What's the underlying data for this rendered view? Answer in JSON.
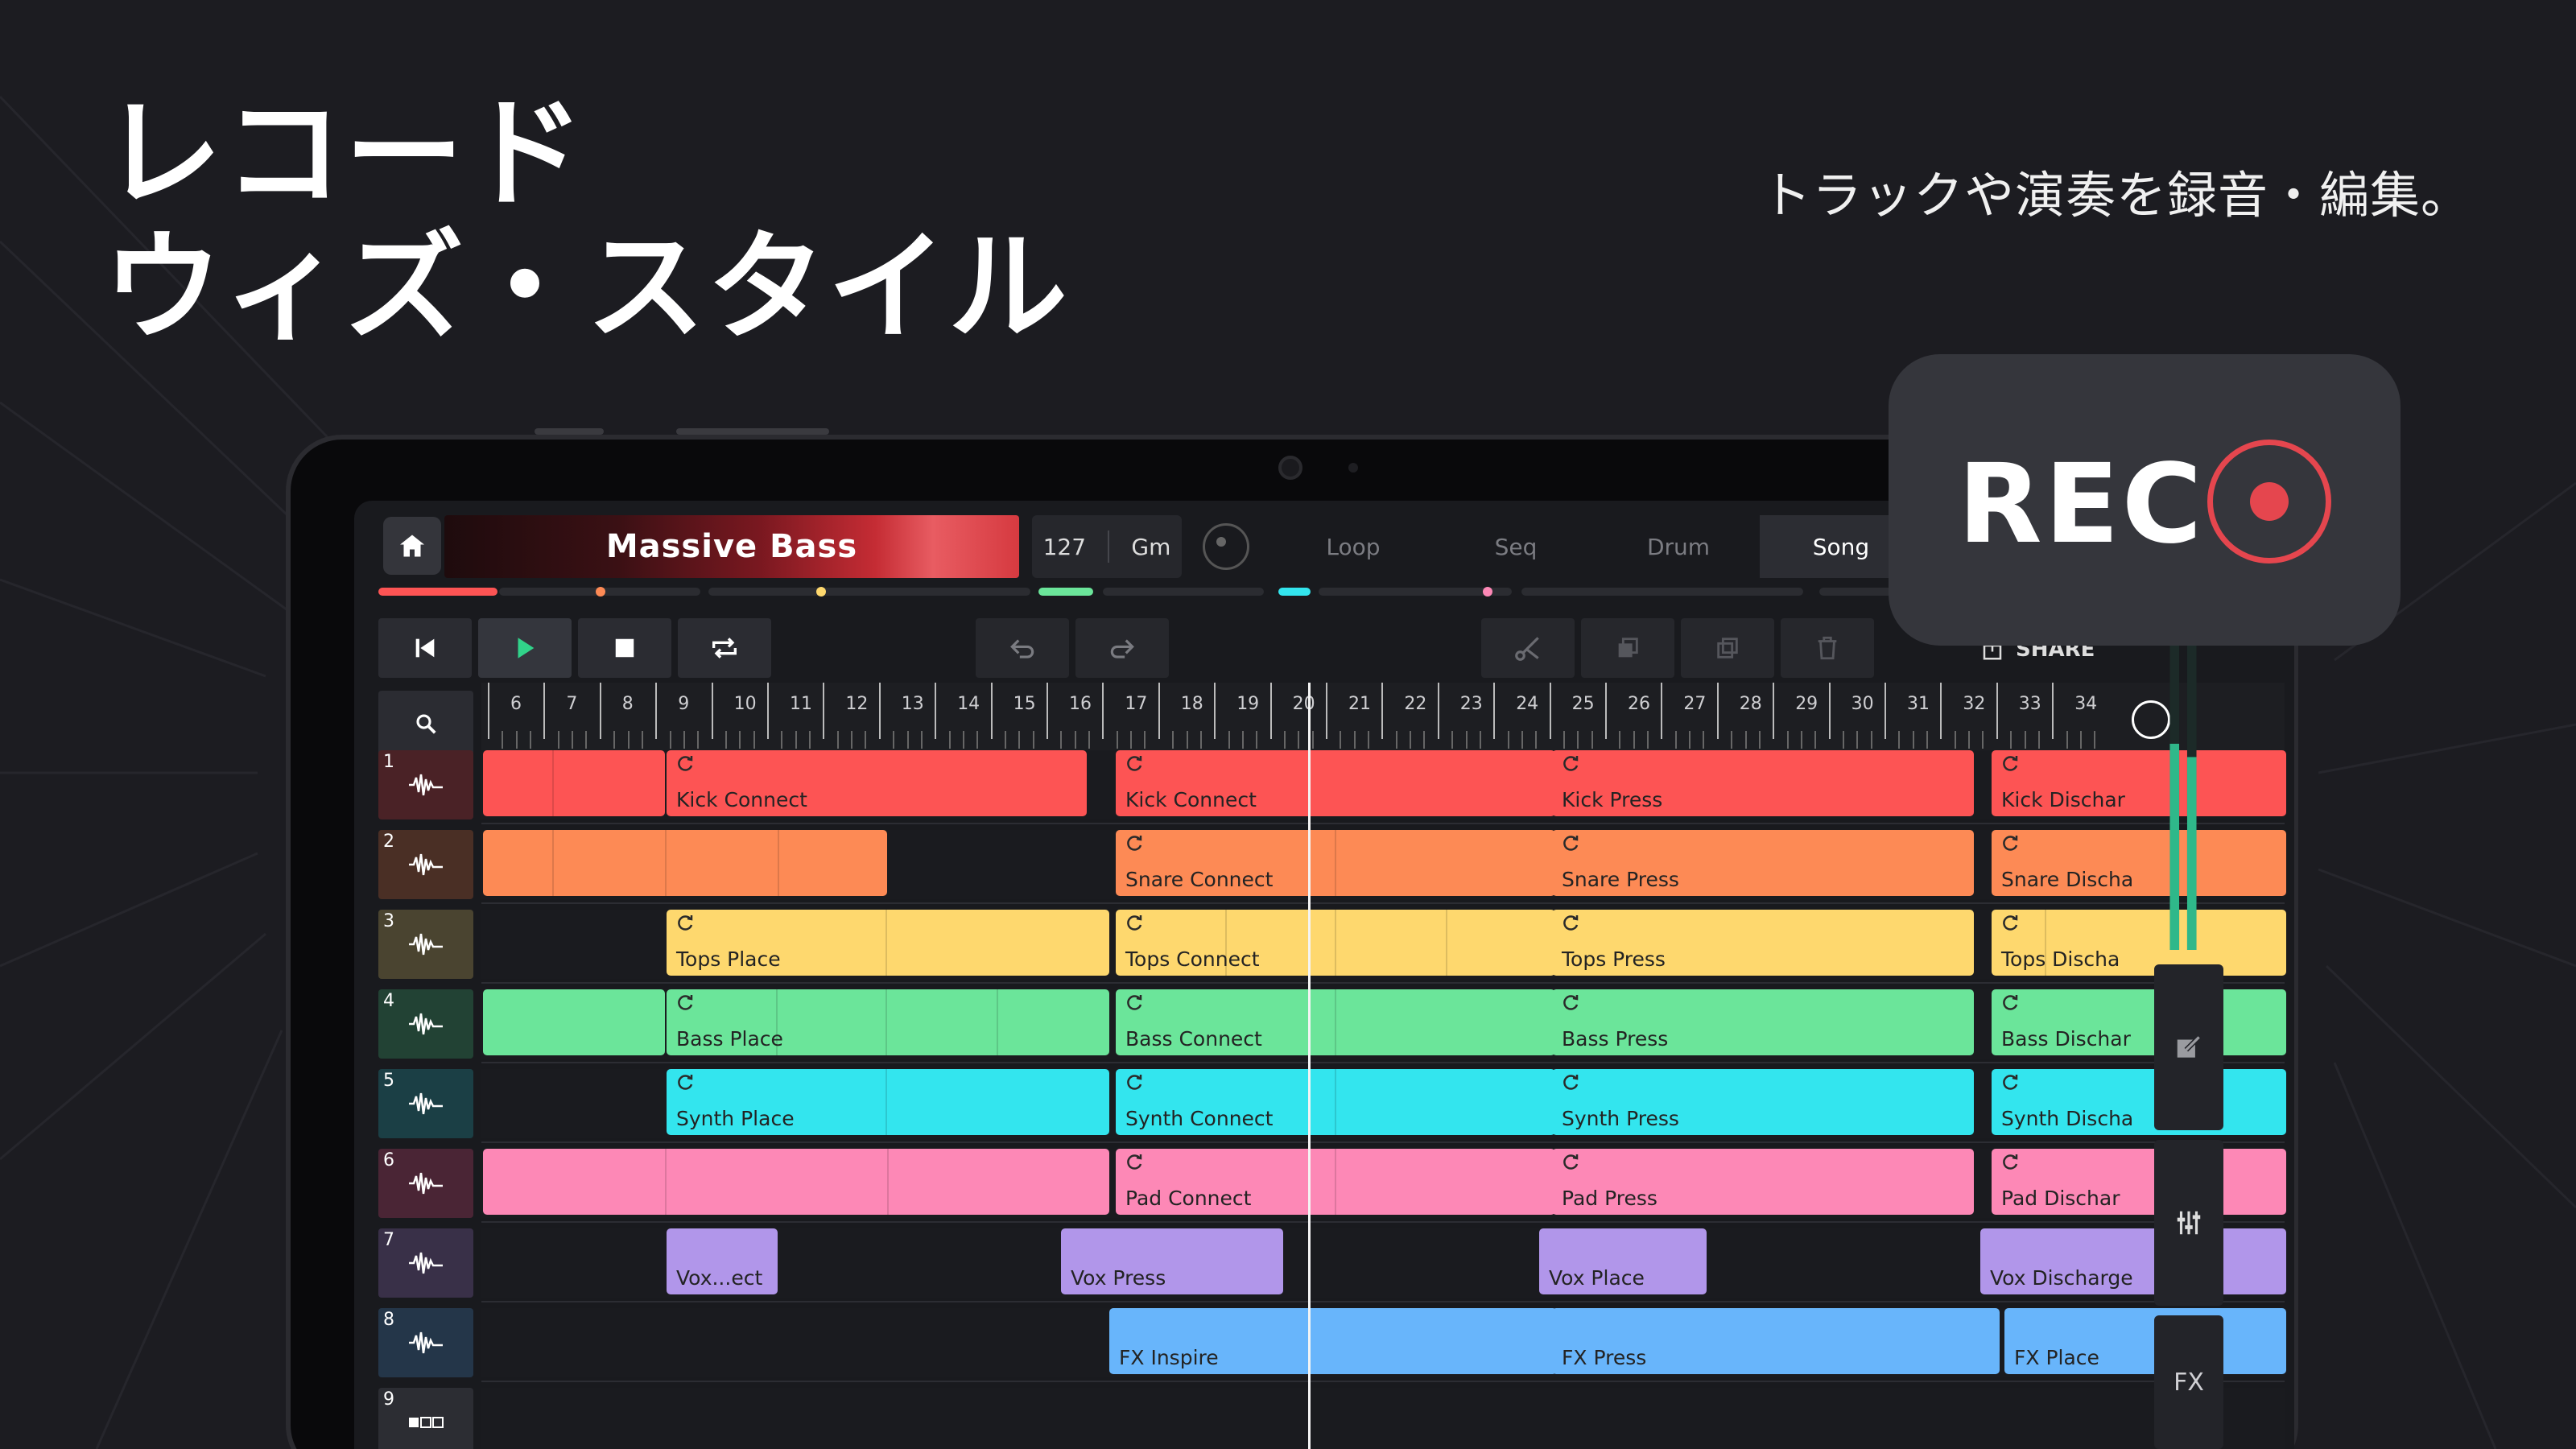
{
  "headline": "レコード\nウィズ・スタイル",
  "subheadline": "トラックや演奏を録音・編集。",
  "rec_badge": {
    "label": "REC",
    "color": "#e5464e"
  },
  "topbar": {
    "home_icon": "home-icon",
    "song_title": "Massive Bass",
    "tempo": "127",
    "key": "Gm",
    "tabs": [
      {
        "label": "Loop",
        "active": false
      },
      {
        "label": "Seq",
        "active": false
      },
      {
        "label": "Drum",
        "active": false
      },
      {
        "label": "Song",
        "active": true
      }
    ]
  },
  "transport": {
    "buttons": [
      "skip-back-icon",
      "play-icon",
      "stop-icon",
      "loop-icon"
    ],
    "edit_buttons": [
      "undo-icon",
      "redo-icon",
      "scissors-icon",
      "duplicate-icon",
      "copy-icon",
      "trash-icon"
    ],
    "share_label": "SHARE"
  },
  "ruler": {
    "bars": [
      "6",
      "7",
      "8",
      "9",
      "10",
      "11",
      "12",
      "13",
      "14",
      "15",
      "16",
      "17",
      "18",
      "19",
      "20",
      "21",
      "22",
      "23",
      "24",
      "25",
      "26",
      "27",
      "28",
      "29",
      "30",
      "31",
      "32",
      "33",
      "34"
    ]
  },
  "tracks": [
    {
      "number": "1",
      "color": "#fd5454",
      "head": "#4a2226",
      "clips": [
        {
          "label": ""
        },
        {
          "label": "Kick Connect"
        },
        {
          "label": "Kick Connect"
        },
        {
          "label": "Kick Press"
        },
        {
          "label": "Kick Dischar"
        }
      ]
    },
    {
      "number": "2",
      "color": "#fd8a55",
      "head": "#4a2f25",
      "clips": [
        {
          "label": ""
        },
        {
          "label": "Snare Connect"
        },
        {
          "label": "Snare Press"
        },
        {
          "label": "Snare Discha"
        }
      ]
    },
    {
      "number": "3",
      "color": "#fed86e",
      "head": "#4a4430",
      "clips": [
        {
          "label": "Tops Place"
        },
        {
          "label": "Tops Connect"
        },
        {
          "label": "Tops Press"
        },
        {
          "label": "Tops Discha"
        }
      ]
    },
    {
      "number": "4",
      "color": "#6be59a",
      "head": "#224234",
      "clips": [
        {
          "label": ""
        },
        {
          "label": "Bass Place"
        },
        {
          "label": "Bass Connect"
        },
        {
          "label": "Bass Press"
        },
        {
          "label": "Bass Dischar"
        }
      ]
    },
    {
      "number": "5",
      "color": "#33e5ee",
      "head": "#1b3f45",
      "clips": [
        {
          "label": "Synth Place"
        },
        {
          "label": "Synth Connect"
        },
        {
          "label": "Synth Press"
        },
        {
          "label": "Synth Discha"
        }
      ]
    },
    {
      "number": "6",
      "color": "#fd88b6",
      "head": "#4a2535",
      "clips": [
        {
          "label": ""
        },
        {
          "label": "Pad Connect"
        },
        {
          "label": "Pad Press"
        },
        {
          "label": "Pad Dischar"
        }
      ]
    },
    {
      "number": "7",
      "color": "#b196ea",
      "head": "#393048",
      "clips": [
        {
          "label": "Vox...ect"
        },
        {
          "label": "Vox Press"
        },
        {
          "label": "Vox Place"
        },
        {
          "label": "Vox Discharge"
        }
      ]
    },
    {
      "number": "8",
      "color": "#68b5fb",
      "head": "#243649",
      "clips": [
        {
          "label": "FX Inspire"
        },
        {
          "label": "FX Press"
        },
        {
          "label": "FX Place"
        }
      ]
    },
    {
      "number": "9",
      "color": "#8e8e96",
      "head": "#2c2d33",
      "clips": []
    }
  ],
  "side_panel": {
    "buttons": [
      "edit-icon",
      "mixer-icon"
    ],
    "fx_label": "FX"
  }
}
